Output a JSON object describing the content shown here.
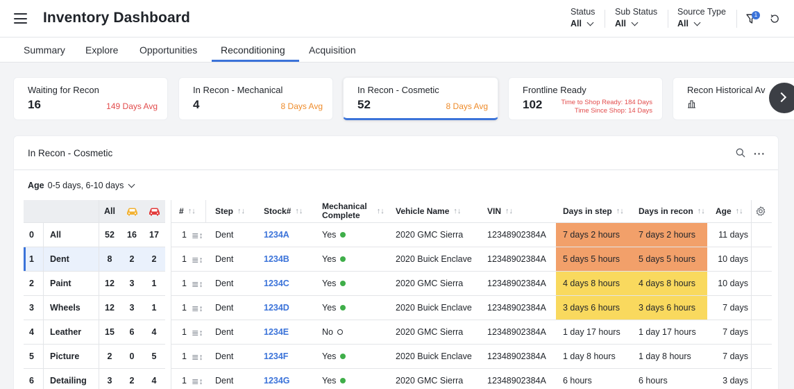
{
  "header": {
    "title": "Inventory Dashboard",
    "filters": [
      {
        "label": "Status",
        "value": "All"
      },
      {
        "label": "Sub Status",
        "value": "All"
      },
      {
        "label": "Source Type",
        "value": "All"
      }
    ],
    "filter_badge": "1"
  },
  "tabs": [
    "Summary",
    "Explore",
    "Opportunities",
    "Reconditioning",
    "Acquisition"
  ],
  "active_tab": "Reconditioning",
  "cards": [
    {
      "title": "Waiting for Recon",
      "value": "16",
      "avg": "149 Days Avg",
      "avg_color": "#e24b4b"
    },
    {
      "title": "In Recon - Mechanical",
      "value": "4",
      "avg": "8 Days Avg",
      "avg_color": "#ee8b2a"
    },
    {
      "title": "In Recon - Cosmetic",
      "value": "52",
      "avg": "8 Days Avg",
      "avg_color": "#ee8b2a"
    },
    {
      "title": "Frontline Ready",
      "value": "102",
      "line1": "Time to Shop Ready: 184 Days",
      "line2": "Time Since Shop: 14 Days"
    },
    {
      "title": "Recon Historical Av"
    }
  ],
  "panel": {
    "title": "In Recon - Cosmetic",
    "age_label": "Age",
    "age_value": "0-5 days, 6-10 days"
  },
  "left_table": {
    "headers": [
      "All"
    ],
    "rows": [
      {
        "idx": "0",
        "name": "All",
        "all": "52",
        "a": "16",
        "b": "17"
      },
      {
        "idx": "1",
        "name": "Dent",
        "all": "8",
        "a": "2",
        "b": "2"
      },
      {
        "idx": "2",
        "name": "Paint",
        "all": "12",
        "a": "3",
        "b": "1"
      },
      {
        "idx": "3",
        "name": "Wheels",
        "all": "12",
        "a": "3",
        "b": "1"
      },
      {
        "idx": "4",
        "name": "Leather",
        "all": "15",
        "a": "6",
        "b": "4"
      },
      {
        "idx": "5",
        "name": "Picture",
        "all": "2",
        "a": "0",
        "b": "5"
      },
      {
        "idx": "6",
        "name": "Detailing",
        "all": "3",
        "a": "2",
        "b": "4"
      }
    ],
    "colors": {
      "car_a": "#f2b233",
      "car_b": "#e23b3b"
    }
  },
  "main_table": {
    "headers": [
      "#",
      "Step",
      "Stock#",
      "Mechanical",
      "Complete",
      "Vehicle Name",
      "VIN",
      "Days in step",
      "Days in recon",
      "Age"
    ],
    "rows": [
      {
        "num": "1",
        "step": "Dent",
        "stock": "1234A",
        "mech": "Yes",
        "vehicle": "2020 GMC Sierra",
        "vin": "12348902384A",
        "dstep": "7 days 2 hours",
        "drecon": "7 days 2 hours",
        "age": "11 days",
        "hl": "orange"
      },
      {
        "num": "1",
        "step": "Dent",
        "stock": "1234B",
        "mech": "Yes",
        "vehicle": "2020 Buick Enclave",
        "vin": "12348902384A",
        "dstep": "5 days 5 hours",
        "drecon": "5 days 5 hours",
        "age": "10 days",
        "hl": "orange"
      },
      {
        "num": "1",
        "step": "Dent",
        "stock": "1234C",
        "mech": "Yes",
        "vehicle": "2020 GMC Sierra",
        "vin": "12348902384A",
        "dstep": "4 days 8 hours",
        "drecon": "4 days 8 hours",
        "age": "10 days",
        "hl": "yellow"
      },
      {
        "num": "1",
        "step": "Dent",
        "stock": "1234D",
        "mech": "Yes",
        "vehicle": "2020 Buick Enclave",
        "vin": "12348902384A",
        "dstep": "3 days 6 hours",
        "drecon": "3 days 6 hours",
        "age": "7 days",
        "hl": "yellow"
      },
      {
        "num": "1",
        "step": "Dent",
        "stock": "1234E",
        "mech": "No",
        "vehicle": "2020 GMC Sierra",
        "vin": "12348902384A",
        "dstep": "1 day 17 hours",
        "drecon": "1 day 17 hours",
        "age": "7 days",
        "hl": ""
      },
      {
        "num": "1",
        "step": "Dent",
        "stock": "1234F",
        "mech": "Yes",
        "vehicle": "2020 Buick Enclave",
        "vin": "12348902384A",
        "dstep": "1 day 8 hours",
        "drecon": "1 day 8 hours",
        "age": "7 days",
        "hl": ""
      },
      {
        "num": "1",
        "step": "Dent",
        "stock": "1234G",
        "mech": "Yes",
        "vehicle": "2020 GMC Sierra",
        "vin": "12348902384A",
        "dstep": "6 hours",
        "drecon": "6 hours",
        "age": "3 days",
        "hl": ""
      }
    ]
  }
}
